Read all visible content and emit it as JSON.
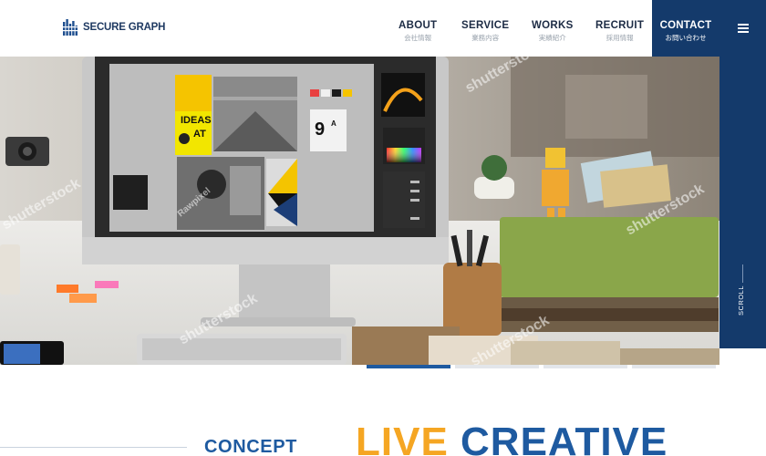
{
  "brand": {
    "name": "SECURE GRAPH"
  },
  "nav": {
    "items": [
      {
        "en": "ABOUT",
        "jp": "会社情報"
      },
      {
        "en": "SERVICE",
        "jp": "業務内容"
      },
      {
        "en": "WORKS",
        "jp": "実績紹介"
      },
      {
        "en": "RECRUIT",
        "jp": "採用情報"
      }
    ],
    "contact": {
      "en": "CONTACT",
      "jp": "お問い合わせ"
    },
    "menu_icon": "hamburger-icon"
  },
  "hero": {
    "screen_text_1": "IDEAS",
    "screen_text_2": "AT",
    "screen_number": "9",
    "screen_number_sup": "A",
    "watermarks": [
      "shutterstock",
      "shutterstock",
      "shutterstock",
      "shutterstock",
      "shutterstock",
      "Rawpixel"
    ]
  },
  "scroll": {
    "label": "SCROLL"
  },
  "slides": {
    "count": 4,
    "active": 1
  },
  "concept": {
    "label": "CONCEPT",
    "headline_word1": "LIVE",
    "headline_word2": "CREATIVE"
  },
  "colors": {
    "navy": "#143a6b",
    "blue": "#1e5aa0",
    "orange": "#f5a623"
  }
}
